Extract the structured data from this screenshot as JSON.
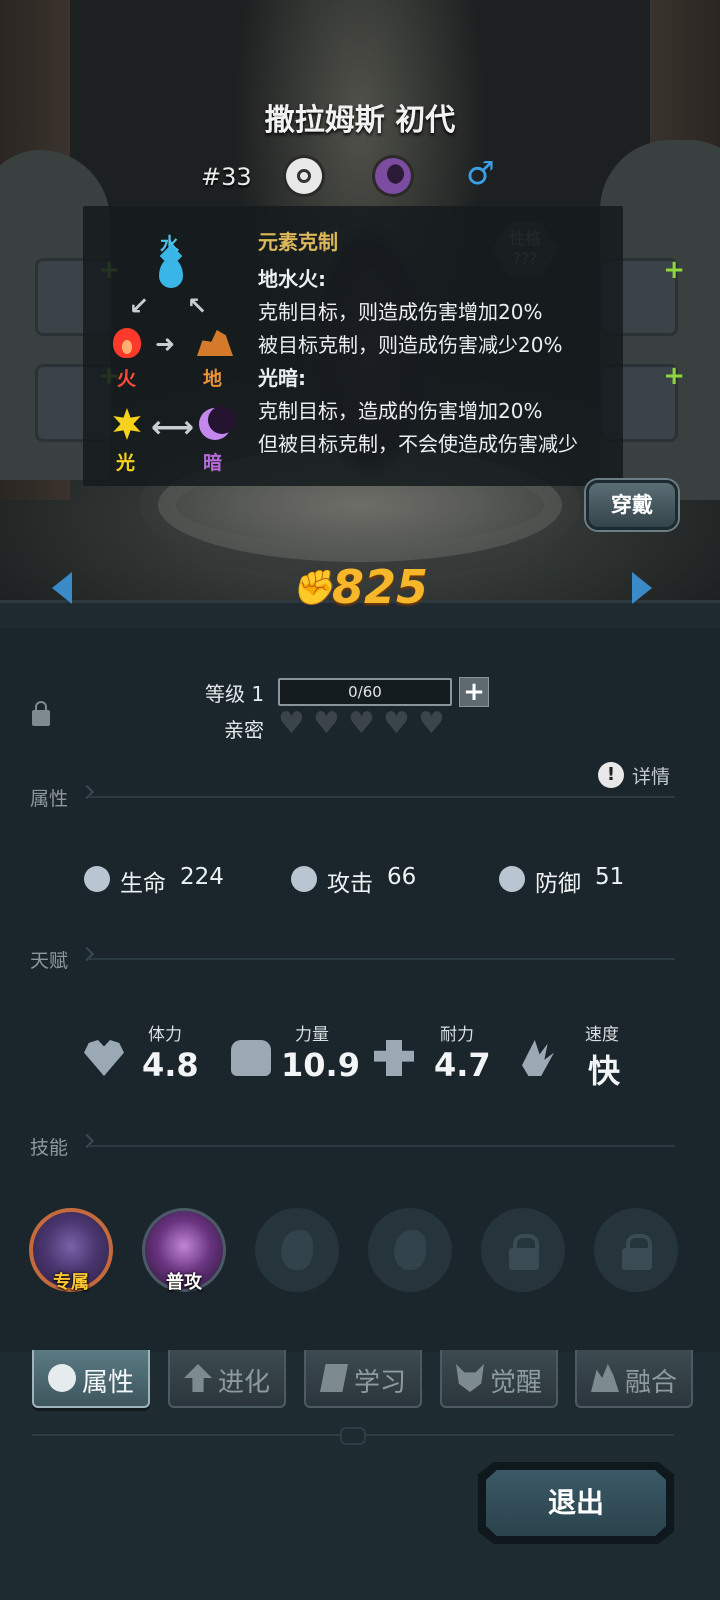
{
  "header": {
    "title": "撒拉姆斯 初代",
    "dex_number": "#33",
    "type_icons": [
      "eye-type-icon",
      "dark-type-icon"
    ],
    "gender_symbol": "♂"
  },
  "personality_badge": {
    "line1": "性格",
    "line2": "???"
  },
  "element_tooltip": {
    "elements": {
      "water": "水",
      "fire": "火",
      "earth": "地",
      "light": "光",
      "dark": "暗"
    },
    "title": "元素克制",
    "lines": [
      {
        "text": "地水火:",
        "bold": true
      },
      {
        "text": "克制目标，则造成伤害增加20%",
        "bold": false
      },
      {
        "text": "被目标克制，则造成伤害减少20%",
        "bold": false
      },
      {
        "text": "光暗:",
        "bold": true
      },
      {
        "text": "克制目标，造成的伤害增加20%",
        "bold": false
      },
      {
        "text": "但被目标克制，不会使造成伤害减少",
        "bold": false
      }
    ]
  },
  "equip_button": "穿戴",
  "combat_power": "825",
  "level": {
    "label": "等级 1",
    "progress": "0/60",
    "plus": "+"
  },
  "intimacy": {
    "label": "亲密",
    "hearts_filled": 0,
    "hearts_total": 5
  },
  "detail_link": {
    "icon": "!",
    "label": "详情"
  },
  "sections": {
    "attributes": "属性",
    "talents": "天赋",
    "skills": "技能"
  },
  "stats": [
    {
      "name": "生命",
      "value": "224",
      "icon": "heart-shield-icon"
    },
    {
      "name": "攻击",
      "value": "66",
      "icon": "sword-icon"
    },
    {
      "name": "防御",
      "value": "51",
      "icon": "shield-icon"
    }
  ],
  "talents": [
    {
      "name": "体力",
      "value": "4.8",
      "icon": "heart-icon"
    },
    {
      "name": "力量",
      "value": "10.9",
      "icon": "fist-icon"
    },
    {
      "name": "耐力",
      "value": "4.7",
      "icon": "muscle-icon"
    },
    {
      "name": "速度",
      "value": "快",
      "icon": "wing-icon"
    }
  ],
  "skills": [
    {
      "label": "专属",
      "state": "exclusive"
    },
    {
      "label": "普攻",
      "state": "normal-attack"
    },
    {
      "label": "",
      "state": "empty"
    },
    {
      "label": "",
      "state": "empty"
    },
    {
      "label": "",
      "state": "locked"
    },
    {
      "label": "",
      "state": "locked"
    }
  ],
  "tabs": [
    {
      "label": "属性",
      "active": true
    },
    {
      "label": "进化",
      "active": false
    },
    {
      "label": "学习",
      "active": false
    },
    {
      "label": "觉醒",
      "active": false
    },
    {
      "label": "融合",
      "active": false
    }
  ],
  "exit_button": "退出",
  "colors": {
    "power": "#f7b72a",
    "water": "#4fc3ea",
    "fire": "#ff4a3a",
    "earth": "#e9923a",
    "light": "#f7d21a",
    "dark": "#b86ad8",
    "tooltip_title": "#ddb85a",
    "plus_green": "#8ed63a"
  }
}
